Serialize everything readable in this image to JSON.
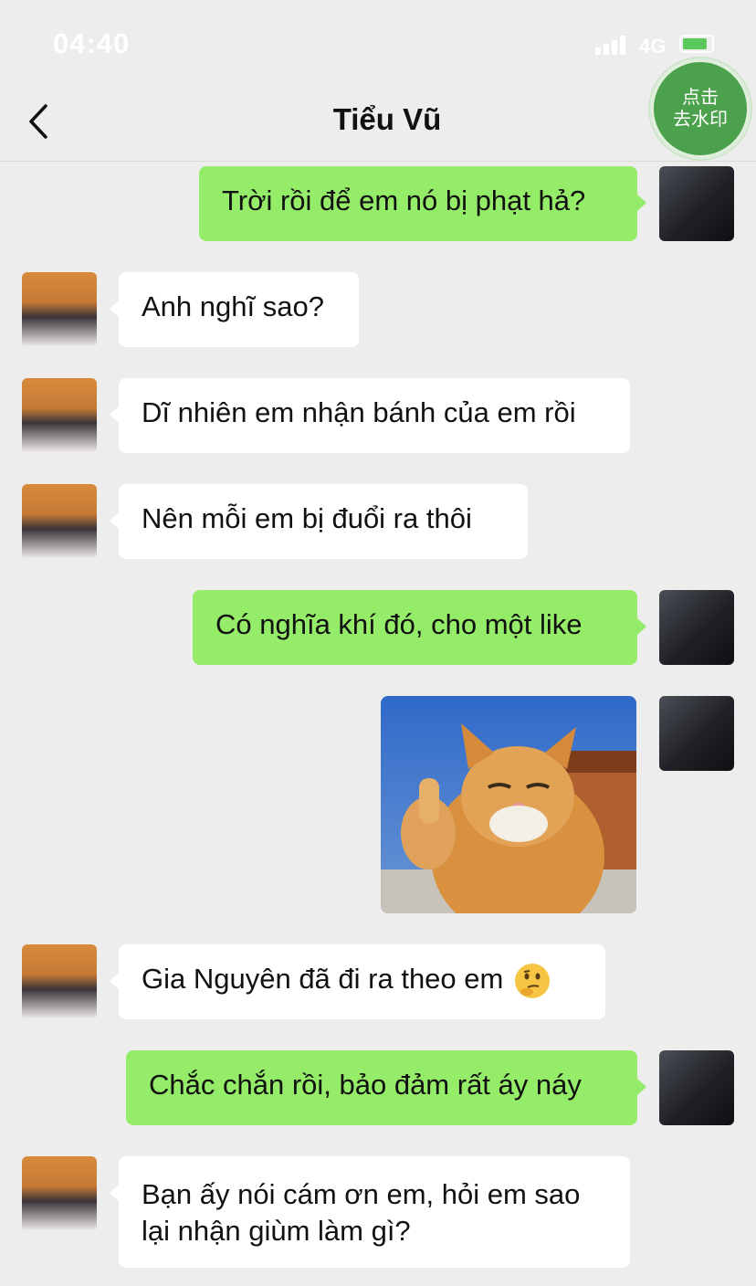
{
  "status_bar": {
    "time": "04:40",
    "network": "4G"
  },
  "nav": {
    "title": "Tiểu Vũ",
    "back_icon": "chevron-left-icon"
  },
  "watermark_button": {
    "line1": "点击",
    "line2": "去水印"
  },
  "messages": [
    {
      "side": "right",
      "text": "Trời rồi để em nó bị phạt hả?"
    },
    {
      "side": "left",
      "text": "Anh nghĩ sao?"
    },
    {
      "side": "left",
      "text": "Dĩ nhiên em nhận bánh của em rồi"
    },
    {
      "side": "left",
      "text": "Nên mỗi em bị đuổi ra thôi"
    },
    {
      "side": "right",
      "text": "Có nghĩa khí đó, cho một like"
    },
    {
      "side": "right",
      "type": "sticker",
      "sticker": "thumbs-up-cat-sticker"
    },
    {
      "side": "left",
      "text": "Gia Nguyên đã đi ra theo em",
      "emoji": "thinking-face-emoji"
    },
    {
      "side": "right",
      "text": "Chắc chắn rồi, bảo đảm rất áy náy"
    },
    {
      "side": "left",
      "text": "Bạn ấy nói cám ơn em, hỏi em sao lại nhận giùm làm gì?"
    }
  ],
  "colors": {
    "background": "#ededed",
    "bubble_right": "#95ec69",
    "bubble_left": "#ffffff",
    "watermark_button": "#4ca24c"
  }
}
